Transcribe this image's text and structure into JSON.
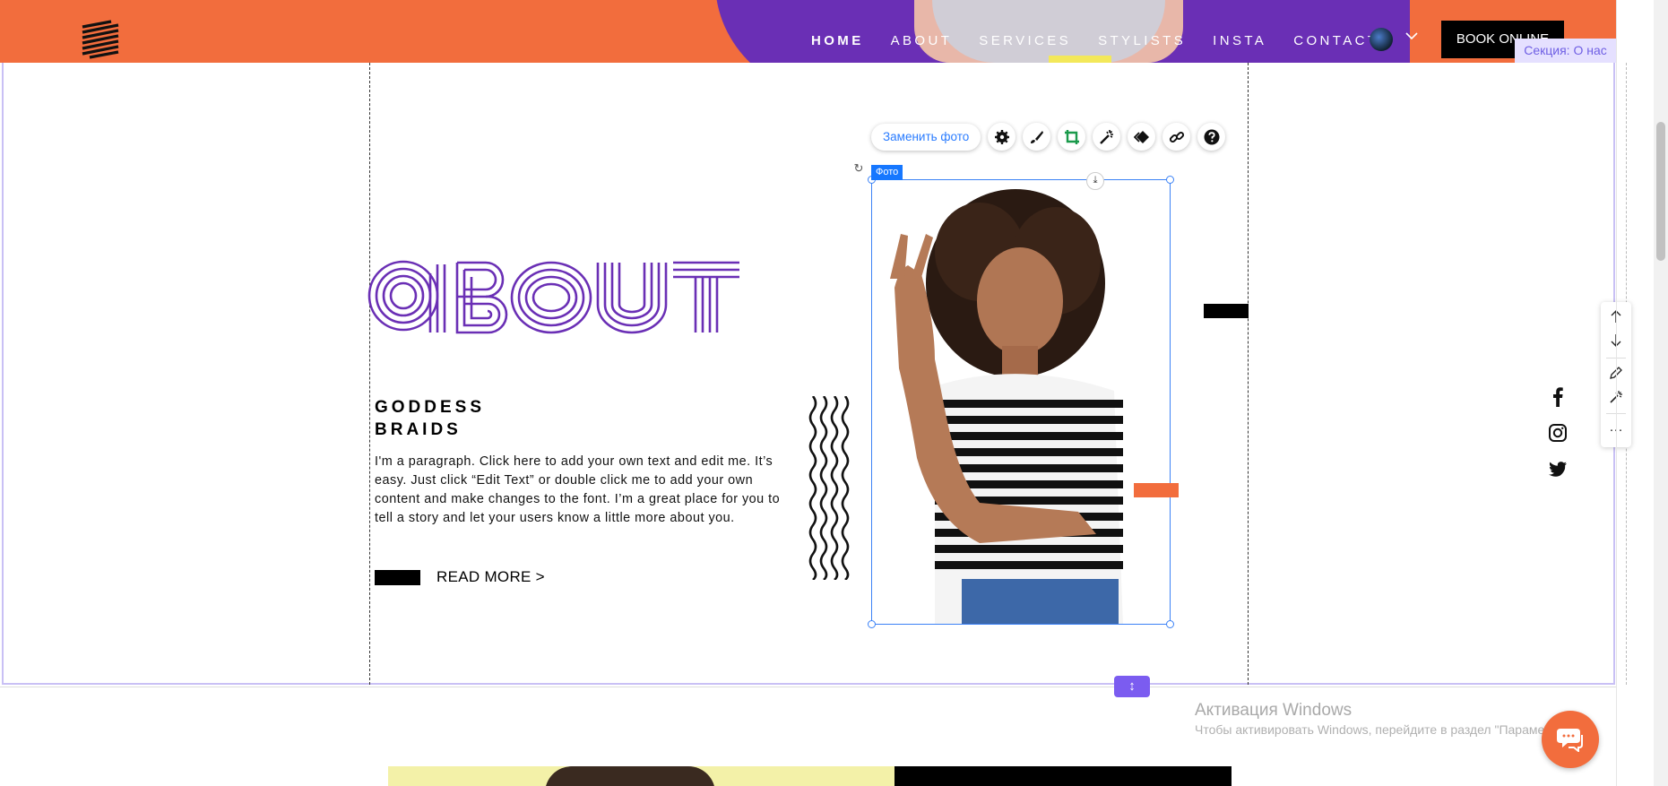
{
  "header": {
    "nav": [
      "HOME",
      "ABOUT",
      "SERVICES",
      "STYLISTS",
      "INSTA",
      "CONTACT"
    ],
    "active_nav": "HOME",
    "book_label": "BOOK ONLINE",
    "section_tag": "Секция: О нас",
    "colors": {
      "orange": "#f26d3d",
      "purple": "#6a2fb5"
    }
  },
  "about": {
    "title_art": "ABOUT",
    "heading_line1": "GODDESS",
    "heading_line2": "BRAIDS",
    "paragraph": "I'm a paragraph. Click here to add your own text and edit me. It’s easy. Just click “Edit Text” or double click me to add your own content and make changes to the font. I’m a great place for you to tell a story and let your users know a little more about you.",
    "read_more": "READ MORE >"
  },
  "editor": {
    "replace_photo": "Заменить фото",
    "photo_tag": "Фото",
    "tools": [
      "gear-icon",
      "brush-icon",
      "crop-icon",
      "magic-wand-icon",
      "animation-icon",
      "link-icon",
      "help-icon"
    ],
    "side_tools": [
      "arrow-up-icon",
      "arrow-down-icon",
      "pencil-icon",
      "magic-wand-icon",
      "more-icon"
    ],
    "more_label": "···"
  },
  "social": [
    "facebook-icon",
    "instagram-icon",
    "twitter-icon"
  ],
  "watermark": {
    "title": "Активация Windows",
    "subtitle": "Чтобы активировать Windows, перейдите в раздел \"Параметры\"."
  }
}
